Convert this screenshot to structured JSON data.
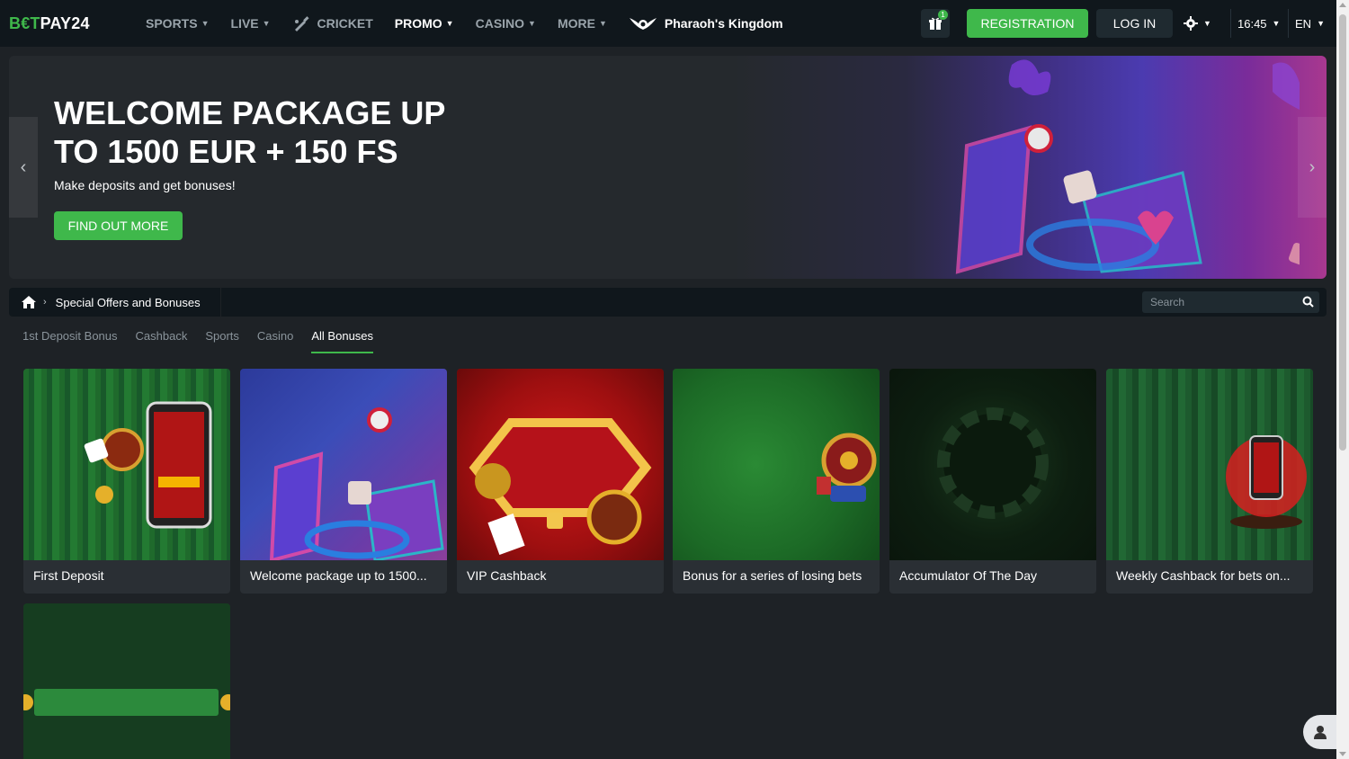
{
  "header": {
    "logo": {
      "part1": "B€T",
      "part2": "PAY24"
    },
    "nav": [
      {
        "label": "SPORTS",
        "has_dropdown": true
      },
      {
        "label": "LIVE",
        "has_dropdown": true
      },
      {
        "label": "CRICKET",
        "icon": "cricket-bat-icon"
      },
      {
        "label": "PROMO",
        "has_dropdown": true,
        "active": true
      },
      {
        "label": "CASINO",
        "has_dropdown": true
      },
      {
        "label": "MORE",
        "has_dropdown": true
      },
      {
        "label": "Pharaoh's Kingdom",
        "icon": "pharaoh-wings-icon"
      }
    ],
    "gift_count": "1",
    "registration_label": "REGISTRATION",
    "login_label": "LOG IN",
    "time": "16:45",
    "language": "EN"
  },
  "banner": {
    "title": "WELCOME PACKAGE UP TO 1500 EUR + 150 FS",
    "subtitle": "Make deposits and get bonuses!",
    "cta": "FIND OUT MORE"
  },
  "breadcrumb": {
    "current": "Special Offers and Bonuses"
  },
  "search": {
    "placeholder": "Search"
  },
  "tabs": [
    {
      "label": "1st Deposit Bonus"
    },
    {
      "label": "Cashback"
    },
    {
      "label": "Sports"
    },
    {
      "label": "Casino"
    },
    {
      "label": "All Bonuses",
      "active": true
    }
  ],
  "cards": [
    {
      "title": "First Deposit"
    },
    {
      "title": "Welcome package up to 1500..."
    },
    {
      "title": "VIP Cashback"
    },
    {
      "title": "Bonus for a series of losing bets"
    },
    {
      "title": "Accumulator Of The Day"
    },
    {
      "title": "Weekly Cashback for bets on..."
    },
    {
      "title": ""
    }
  ],
  "colors": {
    "accent": "#3fb84b",
    "header_bg": "#10171c",
    "page_bg": "#1e2226",
    "card_bg": "#2a2f34"
  }
}
